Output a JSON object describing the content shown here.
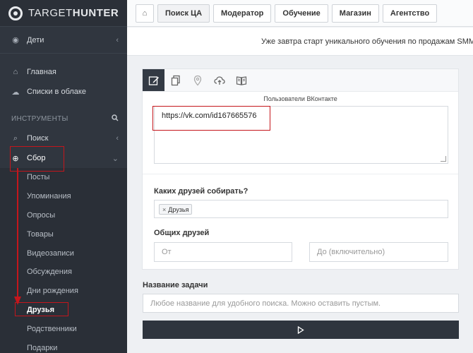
{
  "brand": {
    "name_light": "TARGET",
    "name_bold": "HUNTER"
  },
  "project": {
    "label": "Дети"
  },
  "nav": {
    "home": "Главная",
    "cloud_lists": "Списки в облаке",
    "tools_title": "ИНСТРУМЕНТЫ",
    "search": "Поиск",
    "collect": "Сбор"
  },
  "collect_items": [
    "Посты",
    "Упоминания",
    "Опросы",
    "Товары",
    "Видеозаписи",
    "Обсуждения",
    "Дни рождения",
    "Друзья",
    "Родственники",
    "Подарки"
  ],
  "active_collect_item": "Друзья",
  "header": {
    "buttons": [
      "Поиск ЦА",
      "Модератор",
      "Обучение",
      "Магазин",
      "Агентство"
    ],
    "active": "Поиск ЦА"
  },
  "announcement": "Уже завтра старт уникального обучения по продажам SMM-у",
  "form": {
    "caption": "Пользователи ВКонтакте",
    "url_value": "https://vk.com/id167665576",
    "friends_label": "Каких друзей собирать?",
    "friends_tag": "Друзья",
    "mutual_label": "Общих друзей",
    "from_placeholder": "От",
    "to_placeholder": "До (включительно)",
    "task_label": "Название задачи",
    "task_placeholder": "Любое название для удобного поиска. Можно оставить пустым."
  },
  "icons": {
    "tabs": [
      "edit-icon",
      "copy-icon",
      "location-pin-icon",
      "cloud-upload-icon",
      "book-icon"
    ],
    "run": "play-icon",
    "home": "home-icon"
  },
  "colors": {
    "sidebar": "#30363f",
    "annotation": "#c4161c",
    "active_tab": "#333a44"
  }
}
